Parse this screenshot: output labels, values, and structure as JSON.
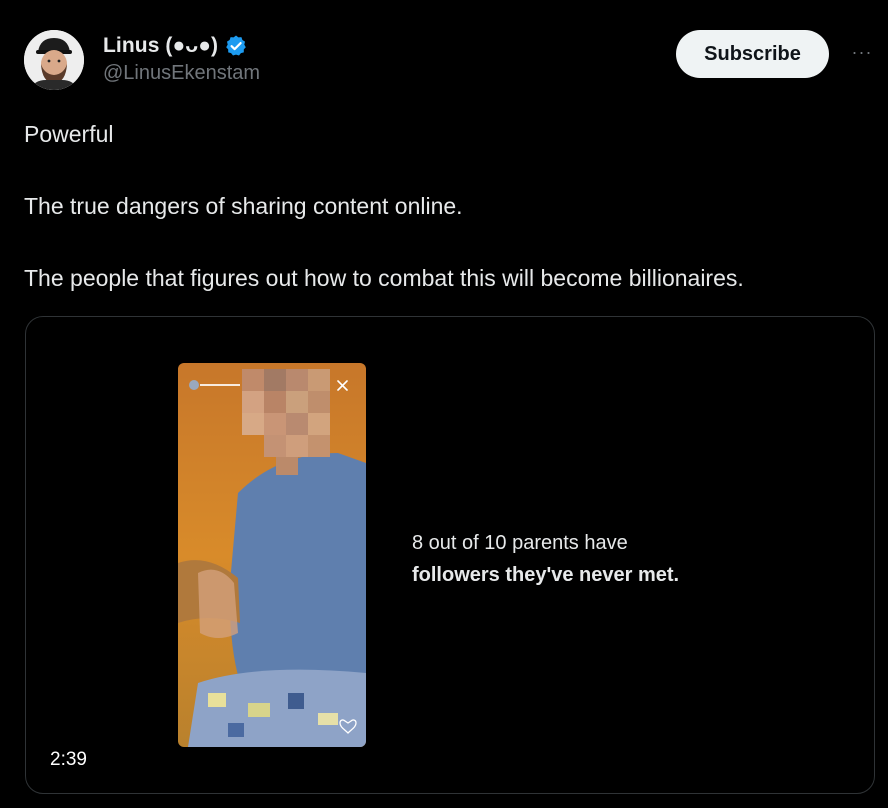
{
  "author": {
    "display_name": "Linus (●ᴗ●)",
    "handle": "@LinusEkenstam",
    "verified": true,
    "avatar_icon": "profile-photo"
  },
  "actions": {
    "subscribe_label": "Subscribe",
    "more_icon": "more-horizontal-icon",
    "more_glyph": "···"
  },
  "tweet": {
    "paragraphs": [
      "Powerful",
      "The true dangers of sharing content online.",
      "The people that figures out how to combat this will become billionaires."
    ]
  },
  "media": {
    "type": "video",
    "duration": "2:39",
    "caption_line1": "8 out of 10 parents have",
    "caption_line2": "followers they've never met."
  },
  "colors": {
    "background": "#000000",
    "text_primary": "#e7e9ea",
    "text_secondary": "#71767b",
    "verified_blue": "#1d9bf0",
    "subscribe_bg": "#eff3f4",
    "media_border": "#2f3336"
  }
}
